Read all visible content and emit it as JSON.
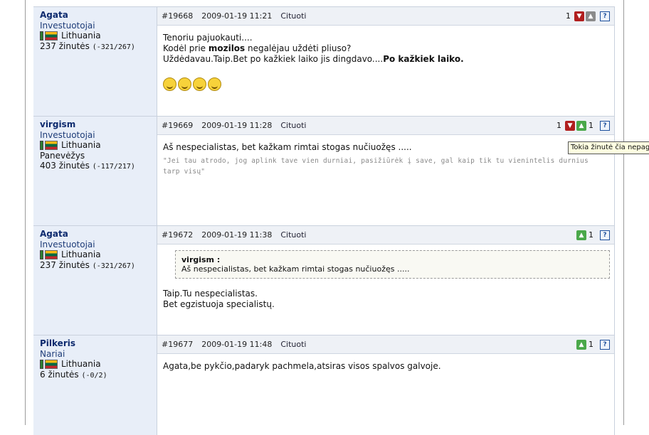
{
  "posts": [
    {
      "author": "Agata",
      "group": "Investuotojai",
      "country": "Lithuania",
      "city": "",
      "count_label": "237 žinutės",
      "ratio": "(-321/267)",
      "id": "#19668",
      "date": "2009-01-19 11:21",
      "quote_label": "Cituoti",
      "votes": {
        "down_count": "1",
        "up_count": ""
      },
      "lines": [
        "Tenoriu pajuokauti....",
        "Kodėl prie ",
        "mozilos",
        " negalėjau uždėti pliuso?",
        "Uždėdavau.Taip.Bet po kažkiek laiko jis dingdavo....",
        "Po kažkiek laiko."
      ],
      "smiley_count": 4
    },
    {
      "author": "virgism",
      "group": "Investuotojai",
      "country": "Lithuania",
      "city": "Panevėžys",
      "count_label": "403 žinutės",
      "ratio": "(-117/217)",
      "id": "#19669",
      "date": "2009-01-19 11:28",
      "quote_label": "Cituoti",
      "votes": {
        "down_count": "1",
        "up_count": "1"
      },
      "text": "Aš nespecialistas, bet kažkam rimtai stogas nučiuožęs .....",
      "signature": "\"Jei tau atrodo, jog aplink tave vien durniai, pasižiūrėk į save, gal kaip tik tu vienintelis durnius tarp visų\""
    },
    {
      "author": "Agata",
      "group": "Investuotojai",
      "country": "Lithuania",
      "city": "",
      "count_label": "237 žinutės",
      "ratio": "(-321/267)",
      "id": "#19672",
      "date": "2009-01-19 11:38",
      "quote_label": "Cituoti",
      "votes": {
        "up_count": "1"
      },
      "quote_author": "virgism :",
      "quote_text": "Aš nespecialistas, bet kažkam rimtai stogas nučiuožęs .....",
      "text1": "Taip.Tu nespecialistas.",
      "text2": "Bet egzistuoja specialistų."
    },
    {
      "author": "Pilkeris",
      "group": "Nariai",
      "country": "Lithuania",
      "city": "",
      "count_label": "6 žinutės",
      "ratio": "(-0/2)",
      "id": "#19677",
      "date": "2009-01-19 11:48",
      "quote_label": "Cituoti",
      "votes": {
        "up_count": "1"
      },
      "text": "Agata,be pykčio,padaryk pachmela,atsiras visos spalvos galvoje."
    }
  ],
  "tooltip": "Tokia žinutė čia nepageidaujama",
  "help_glyph": "?",
  "icons": {
    "down": "thumb-down-icon",
    "up": "thumb-up-icon",
    "help": "help-icon",
    "flag": "lithuania-flag-icon"
  }
}
